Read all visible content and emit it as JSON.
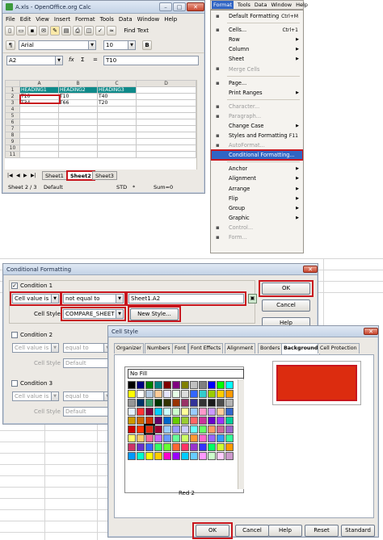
{
  "calc": {
    "title": "A.xls - OpenOffice.org Calc",
    "menus": [
      "File",
      "Edit",
      "View",
      "Insert",
      "Format",
      "Tools",
      "Data",
      "Window",
      "Help"
    ],
    "font_name": "Arial",
    "font_size": "10",
    "find_text": "Find Text",
    "name_box": "A2",
    "formula_value": "T10",
    "formula_icons": [
      "fx",
      "Σ",
      "="
    ],
    "columns": [
      "A",
      "B",
      "C",
      "D"
    ],
    "rows": [
      {
        "num": "1",
        "cells": [
          "HEADING1",
          "HEADING2",
          "HEADING3",
          ""
        ]
      },
      {
        "num": "2",
        "cells": [
          "T10",
          "T10",
          "T40",
          ""
        ]
      },
      {
        "num": "3",
        "cells": [
          "T34",
          "T66",
          "T20",
          ""
        ]
      },
      {
        "num": "4",
        "cells": [
          "",
          "",
          "",
          ""
        ]
      },
      {
        "num": "5",
        "cells": [
          "",
          "",
          "",
          ""
        ]
      },
      {
        "num": "6",
        "cells": [
          "",
          "",
          "",
          ""
        ]
      },
      {
        "num": "7",
        "cells": [
          "",
          "",
          "",
          ""
        ]
      },
      {
        "num": "8",
        "cells": [
          "",
          "",
          "",
          ""
        ]
      },
      {
        "num": "9",
        "cells": [
          "",
          "",
          "",
          ""
        ]
      },
      {
        "num": "10",
        "cells": [
          "",
          "",
          "",
          ""
        ]
      },
      {
        "num": "11",
        "cells": [
          "",
          "",
          "",
          ""
        ]
      }
    ],
    "sheet_tabs": [
      "Sheet1",
      "Sheet2",
      "Sheet3"
    ],
    "status": {
      "sheet": "Sheet 2 / 3",
      "style": "Default",
      "mode": "STD",
      "star": "*",
      "sum": "Sum=0"
    }
  },
  "format_menu": {
    "menubar": [
      "Format",
      "Tools",
      "Data",
      "Window",
      "Help"
    ],
    "items": [
      {
        "label": "Default Formatting",
        "shortcut": "Ctrl+M",
        "arrow": false,
        "disabled": false,
        "icon": "format-default-icon"
      },
      {
        "sep": true
      },
      {
        "label": "Cells...",
        "shortcut": "Ctrl+1",
        "arrow": false,
        "disabled": false,
        "icon": "cells-icon"
      },
      {
        "label": "Row",
        "shortcut": "",
        "arrow": true,
        "disabled": false,
        "icon": ""
      },
      {
        "label": "Column",
        "shortcut": "",
        "arrow": true,
        "disabled": false,
        "icon": ""
      },
      {
        "label": "Sheet",
        "shortcut": "",
        "arrow": true,
        "disabled": false,
        "icon": ""
      },
      {
        "label": "Merge Cells",
        "shortcut": "",
        "arrow": false,
        "disabled": true,
        "icon": "merge-cells-icon"
      },
      {
        "sep": true
      },
      {
        "label": "Page...",
        "shortcut": "",
        "arrow": false,
        "disabled": false,
        "icon": "page-icon"
      },
      {
        "label": "Print Ranges",
        "shortcut": "",
        "arrow": true,
        "disabled": false,
        "icon": ""
      },
      {
        "sep": true
      },
      {
        "label": "Character...",
        "shortcut": "",
        "arrow": false,
        "disabled": true,
        "icon": "character-icon"
      },
      {
        "label": "Paragraph...",
        "shortcut": "",
        "arrow": false,
        "disabled": true,
        "icon": "paragraph-icon"
      },
      {
        "label": "Change Case",
        "shortcut": "",
        "arrow": true,
        "disabled": false,
        "icon": ""
      },
      {
        "label": "Styles and Formatting",
        "shortcut": "F11",
        "arrow": false,
        "disabled": false,
        "icon": "styles-icon"
      },
      {
        "label": "AutoFormat...",
        "shortcut": "",
        "arrow": false,
        "disabled": true,
        "icon": "autoformat-icon"
      },
      {
        "label": "Conditional Formatting...",
        "shortcut": "",
        "arrow": false,
        "disabled": false,
        "highlight": true,
        "icon": ""
      },
      {
        "sep": true
      },
      {
        "label": "Anchor",
        "shortcut": "",
        "arrow": true,
        "disabled": false,
        "icon": ""
      },
      {
        "label": "Alignment",
        "shortcut": "",
        "arrow": true,
        "disabled": false,
        "icon": ""
      },
      {
        "label": "Arrange",
        "shortcut": "",
        "arrow": true,
        "disabled": false,
        "icon": ""
      },
      {
        "label": "Flip",
        "shortcut": "",
        "arrow": true,
        "disabled": false,
        "icon": ""
      },
      {
        "label": "Group",
        "shortcut": "",
        "arrow": true,
        "disabled": false,
        "icon": ""
      },
      {
        "label": "Graphic",
        "shortcut": "",
        "arrow": true,
        "disabled": false,
        "icon": ""
      },
      {
        "label": "Control...",
        "shortcut": "",
        "arrow": false,
        "disabled": true,
        "icon": "control-icon"
      },
      {
        "label": "Form...",
        "shortcut": "",
        "arrow": false,
        "disabled": true,
        "icon": "form-icon"
      }
    ]
  },
  "cond": {
    "title": "Conditional Formatting",
    "c1_label": "Condition 1",
    "c1_type": "Cell value is",
    "c1_op": "not equal to",
    "c1_value": "Sheet1.A2",
    "c1_style_label": "Cell Style",
    "c1_style": "COMPARE_SHEET",
    "new_style": "New Style...",
    "c2_label": "Condition 2",
    "c2_type": "Cell value is",
    "c2_op": "equal to",
    "c2_style_label": "Cell Style",
    "c2_style": "Default",
    "c3_label": "Condition 3",
    "c3_type": "Cell value is",
    "c3_op": "equal to",
    "c3_style_label": "Cell Style",
    "c3_style": "Default",
    "ok": "OK",
    "cancel": "Cancel",
    "help": "Help"
  },
  "cellstyle": {
    "title": "Cell Style",
    "tabs": [
      "Organizer",
      "Numbers",
      "Font",
      "Font Effects",
      "Alignment",
      "Borders",
      "Background",
      "Cell Protection"
    ],
    "no_fill": "No Fill",
    "selected_color_name": "Red 2",
    "preview_color": "#dc2c0f",
    "buttons": [
      "OK",
      "Cancel",
      "Help",
      "Reset",
      "Standard"
    ]
  },
  "palette": [
    "#000000",
    "#000080",
    "#008000",
    "#008080",
    "#800000",
    "#800080",
    "#808000",
    "#c0c0c0",
    "#808080",
    "#0000ff",
    "#00ff00",
    "#00ffff",
    "#ff0000",
    "#ff00ff",
    "#ffff00",
    "#ffffff",
    "#b8cce4",
    "#ffcc99",
    "#e6e6ff",
    "#e6ffe6",
    "#dcdcdc",
    "#3366ff",
    "#33cccc",
    "#99cc00",
    "#ffcc00",
    "#ff9900",
    "#ff6600",
    "#666699",
    "#969696",
    "#003366",
    "#339966",
    "#003300",
    "#333300",
    "#993300",
    "#993366",
    "#333399",
    "#333333",
    "#1a1a1a",
    "#4d4d4d",
    "#b3b3b3",
    "#e6e6e6",
    "#ffffcc",
    "#e6f2ff",
    "#ff3333",
    "#800040",
    "#00ccff",
    "#ccffff",
    "#ccffcc",
    "#ffff99",
    "#99ccff",
    "#ff99cc",
    "#cc99ff",
    "#ffcc99",
    "#3366cc",
    "#33cc66",
    "#cccc00",
    "#cc9900",
    "#cc6600",
    "#cc3300",
    "#660066",
    "#0066cc",
    "#66cc00",
    "#99cc33",
    "#ff6666",
    "#cc3399",
    "#6600cc",
    "#9933ff",
    "#00cc99",
    "#33cccc",
    "#009999",
    "#cc0000",
    "#ff3300",
    "#dc2c0f",
    "#990033",
    "#99ccff",
    "#9999ff",
    "#ccccff",
    "#66ffff",
    "#66ff66",
    "#ff9966",
    "#cc6699",
    "#9966cc",
    "#66cccc",
    "#669966",
    "#ffff66",
    "#ffcc66",
    "#ff6699",
    "#cc66ff",
    "#6699ff",
    "#66ff99",
    "#ccff66",
    "#ff9933",
    "#ff66cc",
    "#9966ff",
    "#3399ff",
    "#33ff99",
    "#99ff33",
    "#ffcc33",
    "#cc3366",
    "#6633cc",
    "#3366ff",
    "#33ff66",
    "#66ff33",
    "#ff6633",
    "#ff3366",
    "#9933cc",
    "#3333ff",
    "#00ff66",
    "#ccff33",
    "#ff9900",
    "#ff3399",
    "#cc33ff",
    "#0099ff",
    "#00ffcc",
    "#ffff00",
    "#ffcc00",
    "#ff00cc",
    "#9900ff",
    "#00ccff",
    "#66ccff",
    "#ff99ff",
    "#ccffcc",
    "#ffccff",
    "#cc99cc",
    "#99cccc",
    "#cccc99"
  ]
}
